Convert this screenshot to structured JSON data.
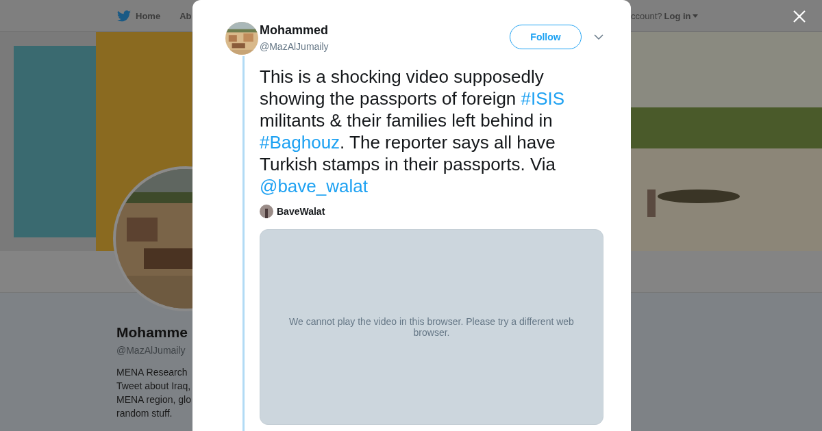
{
  "background_page": {
    "nav": {
      "items": [
        "Home",
        "Ab"
      ],
      "account_prompt": "ccount?",
      "login": "Log in"
    },
    "profile": {
      "name": "Mohamme",
      "handle": "@MazAlJumaily",
      "bio_lines": [
        "MENA Research",
        "Tweet about Iraq,",
        "MENA region, glo",
        "random stuff."
      ]
    }
  },
  "modal": {
    "author": {
      "name": "Mohammed",
      "handle": "@MazAlJumaily"
    },
    "follow_button": "Follow",
    "tweet_text": [
      {
        "kind": "text",
        "text": "This is a shocking video supposedly showing the passports of foreign "
      },
      {
        "kind": "hashtag",
        "text": "#ISIS"
      },
      {
        "kind": "text",
        "text": " militants & their families left behind in "
      },
      {
        "kind": "hashtag",
        "text": "#Baghouz"
      },
      {
        "kind": "text",
        "text": ". The reporter says all have Turkish stamps in their passports. Via "
      },
      {
        "kind": "mention",
        "text": "@bave_walat"
      }
    ],
    "quoted_author": "BaveWalat",
    "video": {
      "message": "We cannot play the video in this browser. Please try a different web browser."
    }
  }
}
